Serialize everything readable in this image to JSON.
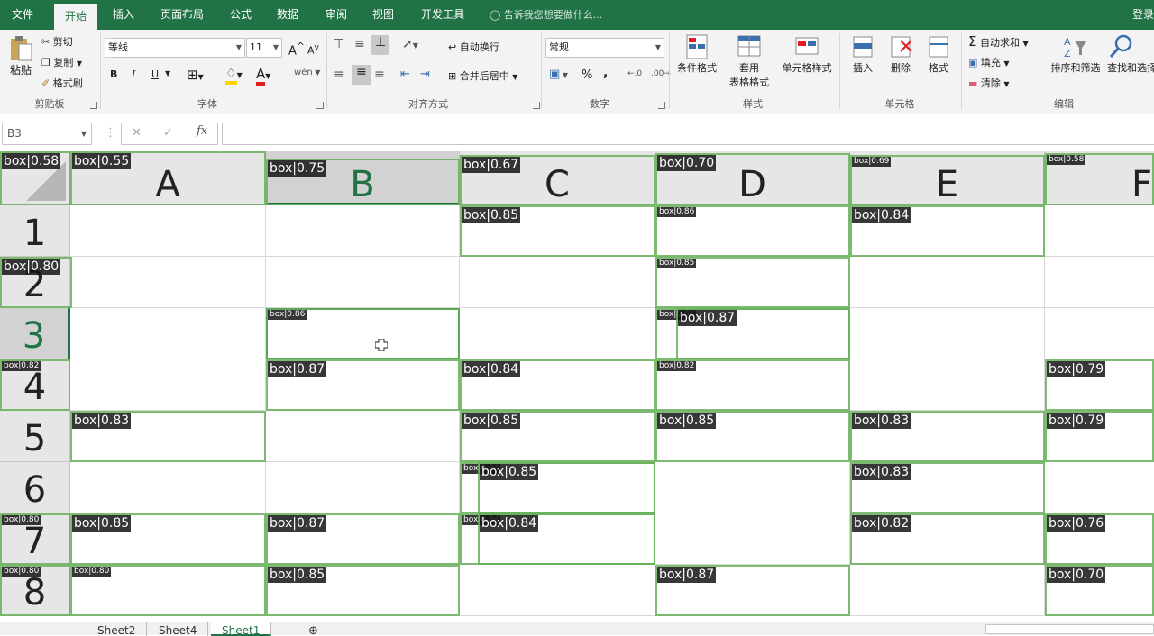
{
  "ribbon_tabs": [
    "文件",
    "开始",
    "插入",
    "页面布局",
    "公式",
    "数据",
    "审阅",
    "视图",
    "开发工具"
  ],
  "tell_me": "告诉我您想要做什么...",
  "login": "登录",
  "clipboard": {
    "paste": "粘贴",
    "cut": "剪切",
    "copy": "复制",
    "format_painter": "格式刷",
    "label": "剪贴板"
  },
  "font": {
    "name": "等线",
    "size": "11",
    "bold": "B",
    "italic": "I",
    "underline": "U",
    "label": "字体",
    "grow": "A",
    "shrink": "A",
    "phonetic": "wén"
  },
  "alignment": {
    "wrap": "自动换行",
    "merge": "合并后居中",
    "label": "对齐方式"
  },
  "number": {
    "format": "常规",
    "percent": "%",
    "comma": ",",
    "label": "数字"
  },
  "styles": {
    "conditional": "条件格式",
    "table_line1": "套用",
    "table_line2": "表格格式",
    "cell_styles": "单元格样式",
    "label": "样式"
  },
  "cells": {
    "insert": "插入",
    "delete": "删除",
    "format": "格式",
    "label": "单元格"
  },
  "editing": {
    "autosum": "自动求和",
    "fill": "填充",
    "clear": "清除",
    "sort": "排序和筛选",
    "find": "查找和选择",
    "label": "编辑"
  },
  "name_box": "B3",
  "fx": "fx",
  "columns": [
    "A",
    "B",
    "C",
    "D",
    "E",
    "F"
  ],
  "rows": [
    "1",
    "2",
    "3",
    "4",
    "5",
    "6",
    "7",
    "8"
  ],
  "selected_cell": "B3",
  "detections": [
    {
      "label": "box|0.58"
    },
    {
      "label": "box|0.55"
    },
    {
      "label": "box|0.75"
    },
    {
      "label": "box|0.67"
    },
    {
      "label": "box|0.70"
    },
    {
      "label": "box|0.69"
    },
    {
      "label": "box|0.58"
    },
    {
      "label": "box|0.85"
    },
    {
      "label": "box|0.86"
    },
    {
      "label": "box|0.84"
    },
    {
      "label": "box|0.80"
    },
    {
      "label": "box|0.85"
    },
    {
      "label": "box|0.86"
    },
    {
      "label": "box|0.86"
    },
    {
      "label": "box|0.87"
    },
    {
      "label": "box|0.82"
    },
    {
      "label": "box|0.87"
    },
    {
      "label": "box|0.84"
    },
    {
      "label": "box|0.82"
    },
    {
      "label": "box|0.79"
    },
    {
      "label": "box|0.83"
    },
    {
      "label": "box|0.85"
    },
    {
      "label": "box|0.85"
    },
    {
      "label": "box|0.83"
    },
    {
      "label": "box|0.79"
    },
    {
      "label": "box|0.84"
    },
    {
      "label": "box|0.85"
    },
    {
      "label": "box|0.83"
    },
    {
      "label": "box|0.80"
    },
    {
      "label": "box|0.85"
    },
    {
      "label": "box|0.87"
    },
    {
      "label": "box|0.84"
    },
    {
      "label": "box|0.84"
    },
    {
      "label": "box|0.82"
    },
    {
      "label": "box|0.76"
    },
    {
      "label": "box|0.80"
    },
    {
      "label": "box|0.80"
    },
    {
      "label": "box|0.85"
    },
    {
      "label": "box|0.87"
    },
    {
      "label": "box|0.70"
    }
  ],
  "sheets": [
    "Sheet2",
    "Sheet4",
    "Sheet1"
  ],
  "active_sheet": "Sheet1",
  "colors": {
    "accent": "#217346",
    "box": "#67b05a"
  }
}
